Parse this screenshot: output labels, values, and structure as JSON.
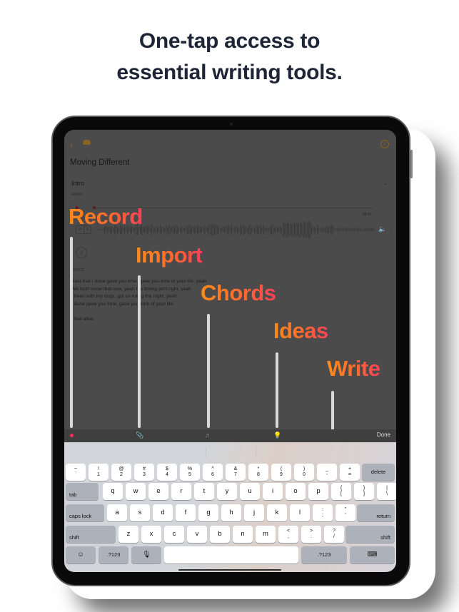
{
  "headline": {
    "line1": "One-tap access to",
    "line2": "essential writing tools."
  },
  "app": {
    "nav": {
      "back_icon": "chevron-left-icon",
      "cloud_icon": "cloud-icon",
      "info_icon": "info-icon",
      "back_glyph": "‹",
      "info_glyph": "i"
    },
    "song_title": "Moving Different",
    "section_title": "Intro",
    "section_chevron": "⌄",
    "audio_label": "AUDIO",
    "audio_time": "03:37",
    "mute_label": "M",
    "solo_label": "S",
    "speaker_glyph": "🔈",
    "more_glyph": "⋮",
    "music_add_glyph": "♫",
    "lyrics_label": "LYRICS",
    "lyrics": "Said that I done gave you time, gave you time of your life, yeah\nWe both know that now, yeah the timing ain't right, yeah\nI been with my dogs, got us ruling the night, yeah\nI done gave you time, gave you time of your life.\n\nI feel alive."
  },
  "callouts": [
    {
      "label": "Record"
    },
    {
      "label": "Import"
    },
    {
      "label": "Chords"
    },
    {
      "label": "Ideas"
    },
    {
      "label": "Write"
    }
  ],
  "toolbar": {
    "record_icon": "record-dot-icon",
    "attach_glyph": "📎",
    "chords_glyph": "♬",
    "idea_glyph": "💡",
    "done_label": "Done"
  },
  "keyboard": {
    "row1": [
      {
        "top": "~",
        "bottom": "`"
      },
      {
        "top": "!",
        "bottom": "1"
      },
      {
        "top": "@",
        "bottom": "2"
      },
      {
        "top": "#",
        "bottom": "3"
      },
      {
        "top": "$",
        "bottom": "4"
      },
      {
        "top": "%",
        "bottom": "5"
      },
      {
        "top": "^",
        "bottom": "6"
      },
      {
        "top": "&",
        "bottom": "7"
      },
      {
        "top": "*",
        "bottom": "8"
      },
      {
        "top": "(",
        "bottom": "9"
      },
      {
        "top": ")",
        "bottom": "0"
      },
      {
        "top": "_",
        "bottom": "-"
      },
      {
        "top": "+",
        "bottom": "="
      }
    ],
    "delete_label": "delete",
    "tab_label": "tab",
    "row2": [
      "q",
      "w",
      "e",
      "r",
      "t",
      "y",
      "u",
      "i",
      "o",
      "p"
    ],
    "row2_extra": [
      {
        "top": "{",
        "bottom": "["
      },
      {
        "top": "}",
        "bottom": "]"
      },
      {
        "top": "|",
        "bottom": "\\"
      }
    ],
    "caps_label": "caps lock",
    "row3": [
      "a",
      "s",
      "d",
      "f",
      "g",
      "h",
      "j",
      "k",
      "l"
    ],
    "row3_extra": [
      {
        "top": ":",
        "bottom": ";"
      },
      {
        "top": "\"",
        "bottom": "'"
      }
    ],
    "return_label": "return",
    "shift_label": "shift",
    "row4": [
      "z",
      "x",
      "c",
      "v",
      "b",
      "n",
      "m"
    ],
    "row4_extra": [
      {
        "top": "<",
        "bottom": ","
      },
      {
        "top": ">",
        "bottom": "."
      },
      {
        "top": "?",
        "bottom": "/"
      }
    ],
    "emoji_glyph": "☺",
    "numbers_label": ".?123",
    "mic_glyph": "🎙",
    "hide_glyph": "⌨"
  }
}
